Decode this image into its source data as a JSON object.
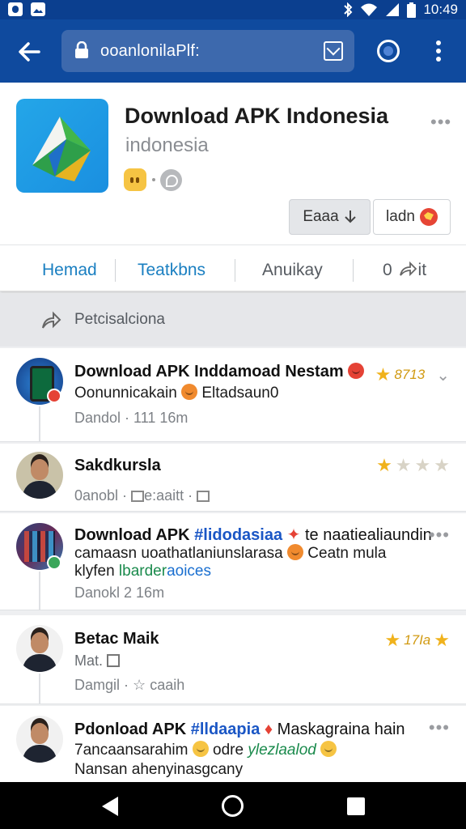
{
  "status_bar": {
    "time": "10:49"
  },
  "toolbar": {
    "url": "ooanlonilaPlf:"
  },
  "app": {
    "title": "Download APK Indonesia",
    "subtitle": "indonesia",
    "btn_download": "Eaaa",
    "btn_open": "ladn",
    "more": "•••"
  },
  "tabs": [
    {
      "label": "Hemad",
      "color": "#1a7fc1"
    },
    {
      "label": "Teatkbns",
      "color": "#1a7fc1"
    },
    {
      "label": "Anuikay",
      "color": "#555a60"
    },
    {
      "label": "0",
      "color": "#555a60"
    },
    {
      "label": "it",
      "color": "#555a60"
    }
  ],
  "composer": {
    "placeholder": "Petcisalciona"
  },
  "feed": [
    {
      "avatar": "phone-icon",
      "title": "Download APK Inddamoad Nestam",
      "body1": "Oonunnicakain",
      "body1b": "Eltadsaun0",
      "meta": "Dandol ·  111 16m",
      "rating_text": "8713"
    },
    {
      "avatar": "person",
      "title": "Sakdkursla",
      "meta1": "0anobl ·",
      "meta2": "e:aaitt ·"
    },
    {
      "avatar": "grid",
      "title_a": "Download APK",
      "title_hash": "#lidodasiaa",
      "title_b": "te naatiealiaundin",
      "body1": "camaasn uoathatlaniunslarasa",
      "body1b": "Ceatn mula",
      "body2a": "klyfen ",
      "body2b": "lbarder",
      "body2c": "aoices",
      "meta": "Danokl   2 16m",
      "more": "•••"
    },
    {
      "avatar": "person",
      "title": "Betac Maik",
      "meta1": "Mat.",
      "meta2": "Damgil ·",
      "meta2b": "caaih",
      "rating_text": "17Ia"
    },
    {
      "avatar": "person",
      "title_a": "Pdonload APK",
      "title_hash": "#lldaapia",
      "title_b": "Maskagraina hain",
      "body1": "7ancaansarahim",
      "body1b": "odre",
      "body1c": "ylezlaalod",
      "body2": "Nansan ahenyinasgcany",
      "more": "•••"
    }
  ]
}
